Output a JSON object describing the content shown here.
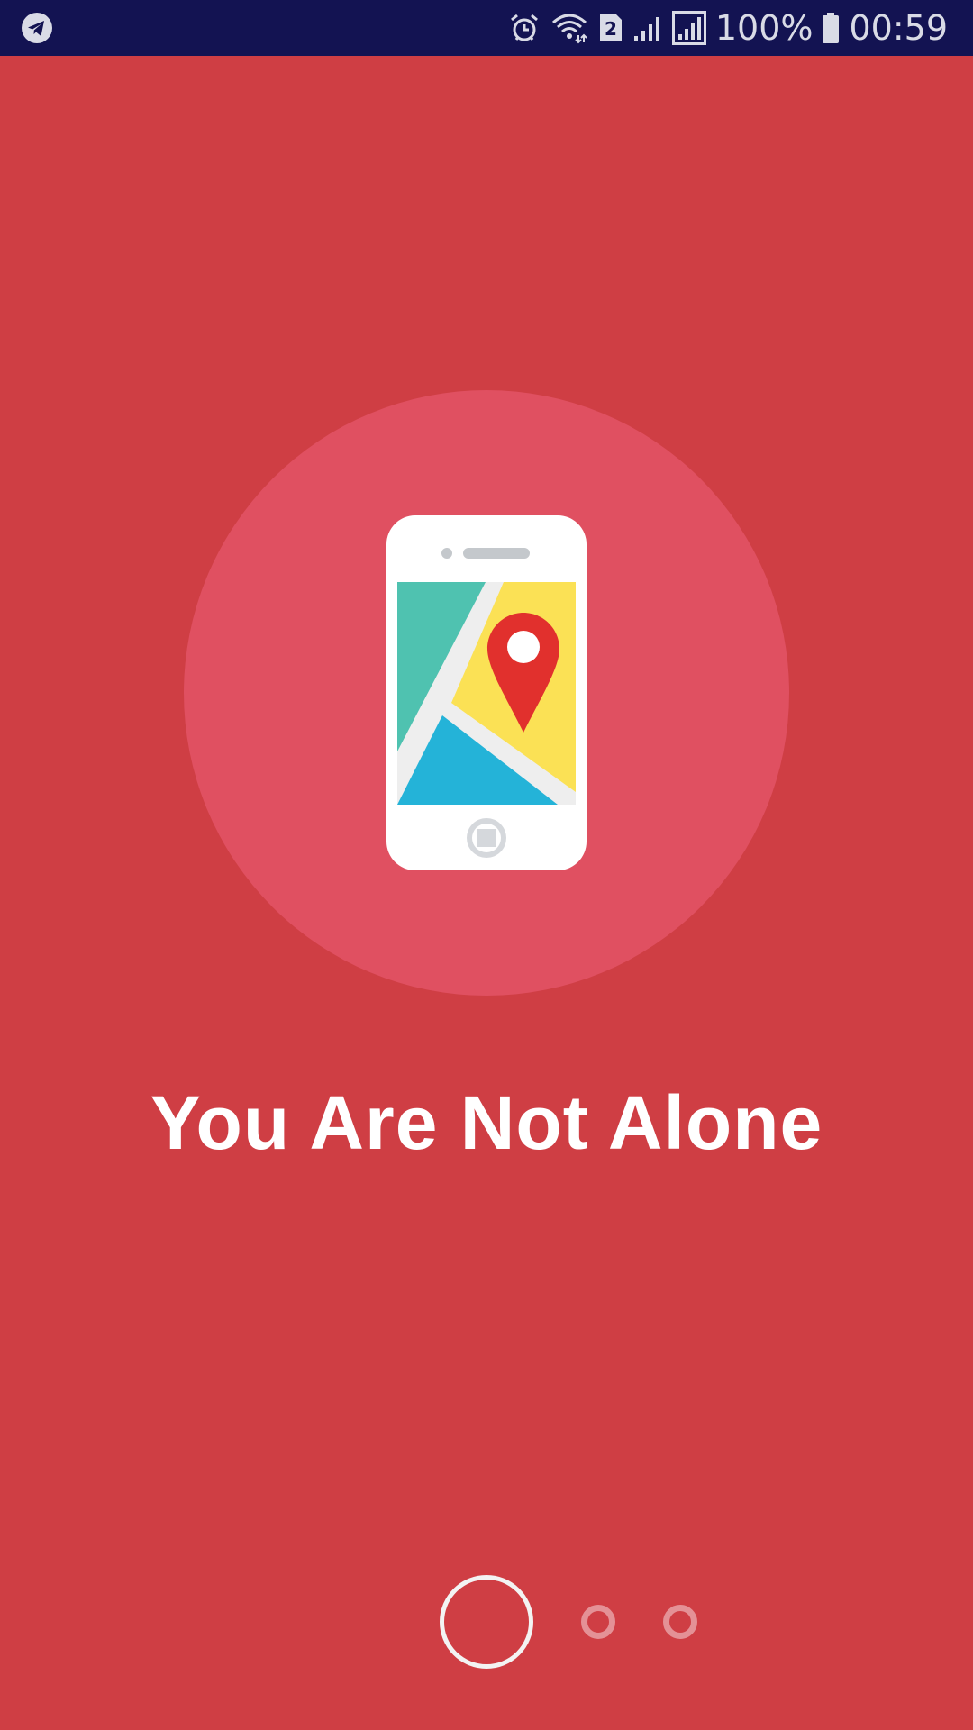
{
  "status_bar": {
    "battery_percent": "100%",
    "time": "00:59",
    "sim_badge": "2",
    "icons": [
      "telegram-icon",
      "alarm-icon",
      "wifi-icon",
      "sim-icon",
      "signal-icon",
      "signal-icon",
      "battery-icon"
    ]
  },
  "onboarding": {
    "title": "You Are Not Alone",
    "illustration": "phone-map-pin-icon",
    "pages_total": 3,
    "current_page": 1
  },
  "colors": {
    "background": "#cf3e44",
    "status_bar": "#131352",
    "hero_circle": "#e05061",
    "text": "#ffffff"
  }
}
